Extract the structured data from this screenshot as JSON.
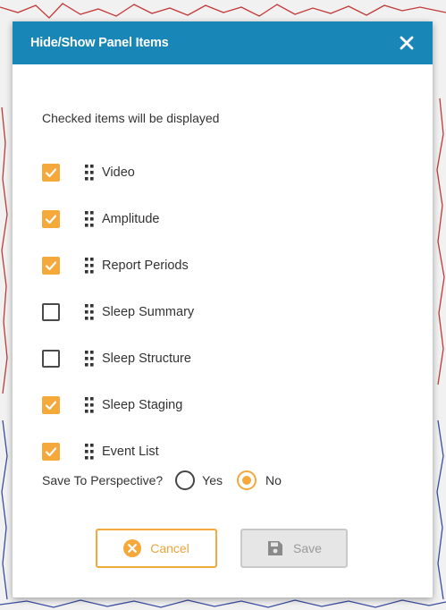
{
  "dialog": {
    "title": "Hide/Show Panel Items",
    "close_icon": "close-icon",
    "instructions": "Checked items will be displayed",
    "items": [
      {
        "label": "Video",
        "checked": true
      },
      {
        "label": "Amplitude",
        "checked": true
      },
      {
        "label": "Report Periods",
        "checked": true
      },
      {
        "label": "Sleep Summary",
        "checked": false
      },
      {
        "label": "Sleep Structure",
        "checked": false
      },
      {
        "label": "Sleep Staging",
        "checked": true
      },
      {
        "label": "Event List",
        "checked": true
      }
    ],
    "save_perspective": {
      "label": "Save To Perspective?",
      "options": [
        {
          "label": "Yes",
          "selected": false
        },
        {
          "label": "No",
          "selected": true
        }
      ]
    },
    "buttons": {
      "cancel_label": "Cancel",
      "save_label": "Save"
    }
  },
  "colors": {
    "header": "#1887b8",
    "accent": "#f5a93b",
    "trace_red": "#c23a3a",
    "trace_blue": "#3b4ea0"
  }
}
